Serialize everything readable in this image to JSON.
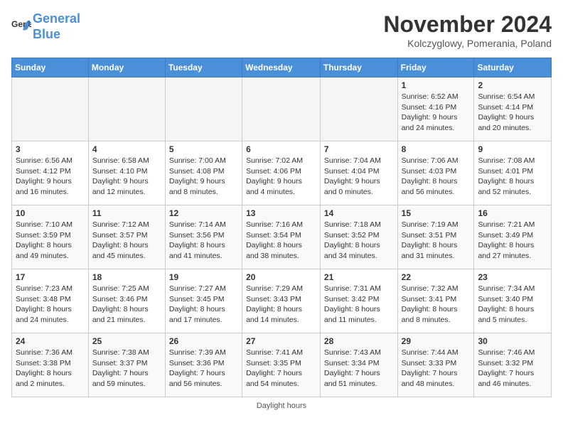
{
  "header": {
    "logo_line1": "General",
    "logo_line2": "Blue",
    "month_title": "November 2024",
    "subtitle": "Kolczyglowy, Pomerania, Poland"
  },
  "days_of_week": [
    "Sunday",
    "Monday",
    "Tuesday",
    "Wednesday",
    "Thursday",
    "Friday",
    "Saturday"
  ],
  "weeks": [
    [
      {
        "day": "",
        "info": ""
      },
      {
        "day": "",
        "info": ""
      },
      {
        "day": "",
        "info": ""
      },
      {
        "day": "",
        "info": ""
      },
      {
        "day": "",
        "info": ""
      },
      {
        "day": "1",
        "info": "Sunrise: 6:52 AM\nSunset: 4:16 PM\nDaylight: 9 hours and 24 minutes."
      },
      {
        "day": "2",
        "info": "Sunrise: 6:54 AM\nSunset: 4:14 PM\nDaylight: 9 hours and 20 minutes."
      }
    ],
    [
      {
        "day": "3",
        "info": "Sunrise: 6:56 AM\nSunset: 4:12 PM\nDaylight: 9 hours and 16 minutes."
      },
      {
        "day": "4",
        "info": "Sunrise: 6:58 AM\nSunset: 4:10 PM\nDaylight: 9 hours and 12 minutes."
      },
      {
        "day": "5",
        "info": "Sunrise: 7:00 AM\nSunset: 4:08 PM\nDaylight: 9 hours and 8 minutes."
      },
      {
        "day": "6",
        "info": "Sunrise: 7:02 AM\nSunset: 4:06 PM\nDaylight: 9 hours and 4 minutes."
      },
      {
        "day": "7",
        "info": "Sunrise: 7:04 AM\nSunset: 4:04 PM\nDaylight: 9 hours and 0 minutes."
      },
      {
        "day": "8",
        "info": "Sunrise: 7:06 AM\nSunset: 4:03 PM\nDaylight: 8 hours and 56 minutes."
      },
      {
        "day": "9",
        "info": "Sunrise: 7:08 AM\nSunset: 4:01 PM\nDaylight: 8 hours and 52 minutes."
      }
    ],
    [
      {
        "day": "10",
        "info": "Sunrise: 7:10 AM\nSunset: 3:59 PM\nDaylight: 8 hours and 49 minutes."
      },
      {
        "day": "11",
        "info": "Sunrise: 7:12 AM\nSunset: 3:57 PM\nDaylight: 8 hours and 45 minutes."
      },
      {
        "day": "12",
        "info": "Sunrise: 7:14 AM\nSunset: 3:56 PM\nDaylight: 8 hours and 41 minutes."
      },
      {
        "day": "13",
        "info": "Sunrise: 7:16 AM\nSunset: 3:54 PM\nDaylight: 8 hours and 38 minutes."
      },
      {
        "day": "14",
        "info": "Sunrise: 7:18 AM\nSunset: 3:52 PM\nDaylight: 8 hours and 34 minutes."
      },
      {
        "day": "15",
        "info": "Sunrise: 7:19 AM\nSunset: 3:51 PM\nDaylight: 8 hours and 31 minutes."
      },
      {
        "day": "16",
        "info": "Sunrise: 7:21 AM\nSunset: 3:49 PM\nDaylight: 8 hours and 27 minutes."
      }
    ],
    [
      {
        "day": "17",
        "info": "Sunrise: 7:23 AM\nSunset: 3:48 PM\nDaylight: 8 hours and 24 minutes."
      },
      {
        "day": "18",
        "info": "Sunrise: 7:25 AM\nSunset: 3:46 PM\nDaylight: 8 hours and 21 minutes."
      },
      {
        "day": "19",
        "info": "Sunrise: 7:27 AM\nSunset: 3:45 PM\nDaylight: 8 hours and 17 minutes."
      },
      {
        "day": "20",
        "info": "Sunrise: 7:29 AM\nSunset: 3:43 PM\nDaylight: 8 hours and 14 minutes."
      },
      {
        "day": "21",
        "info": "Sunrise: 7:31 AM\nSunset: 3:42 PM\nDaylight: 8 hours and 11 minutes."
      },
      {
        "day": "22",
        "info": "Sunrise: 7:32 AM\nSunset: 3:41 PM\nDaylight: 8 hours and 8 minutes."
      },
      {
        "day": "23",
        "info": "Sunrise: 7:34 AM\nSunset: 3:40 PM\nDaylight: 8 hours and 5 minutes."
      }
    ],
    [
      {
        "day": "24",
        "info": "Sunrise: 7:36 AM\nSunset: 3:38 PM\nDaylight: 8 hours and 2 minutes."
      },
      {
        "day": "25",
        "info": "Sunrise: 7:38 AM\nSunset: 3:37 PM\nDaylight: 7 hours and 59 minutes."
      },
      {
        "day": "26",
        "info": "Sunrise: 7:39 AM\nSunset: 3:36 PM\nDaylight: 7 hours and 56 minutes."
      },
      {
        "day": "27",
        "info": "Sunrise: 7:41 AM\nSunset: 3:35 PM\nDaylight: 7 hours and 54 minutes."
      },
      {
        "day": "28",
        "info": "Sunrise: 7:43 AM\nSunset: 3:34 PM\nDaylight: 7 hours and 51 minutes."
      },
      {
        "day": "29",
        "info": "Sunrise: 7:44 AM\nSunset: 3:33 PM\nDaylight: 7 hours and 48 minutes."
      },
      {
        "day": "30",
        "info": "Sunrise: 7:46 AM\nSunset: 3:32 PM\nDaylight: 7 hours and 46 minutes."
      }
    ]
  ],
  "footer": "Daylight hours"
}
